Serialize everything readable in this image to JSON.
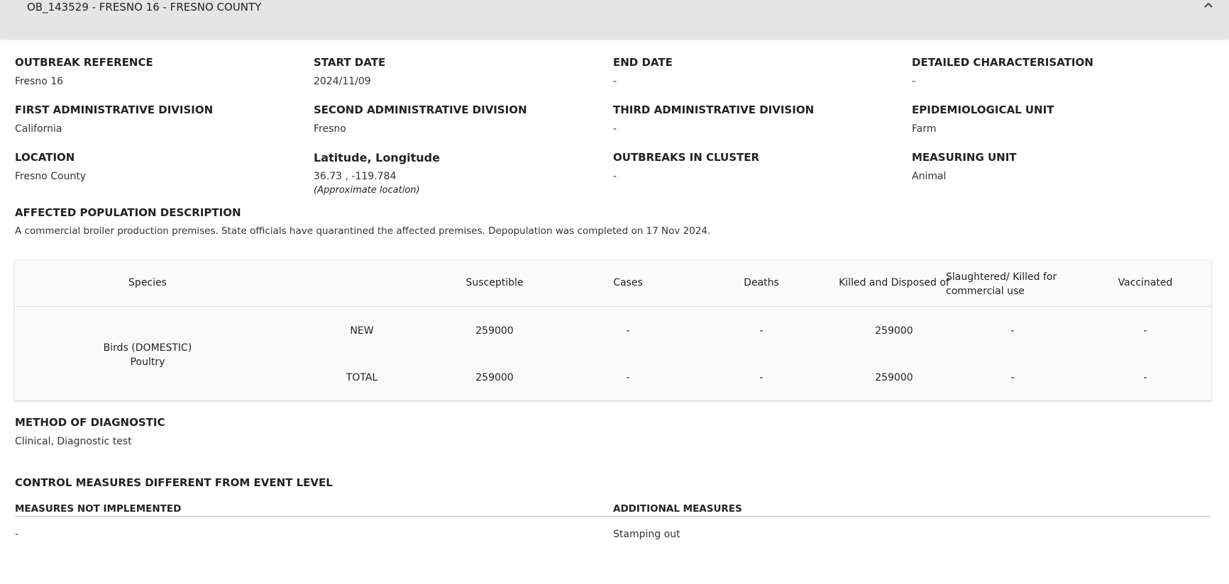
{
  "header": {
    "title": "OB_143529 - FRESNO 16 - FRESNO COUNTY",
    "collapse_icon": "chevron-up-icon"
  },
  "fields": {
    "outbreak_reference": {
      "label": "OUTBREAK REFERENCE",
      "value": "Fresno 16"
    },
    "start_date": {
      "label": "START DATE",
      "value": "2024/11/09"
    },
    "end_date": {
      "label": "END DATE",
      "value": "-"
    },
    "detailed_characterisation": {
      "label": "DETAILED CHARACTERISATION",
      "value": "-"
    },
    "first_admin_division": {
      "label": "FIRST ADMINISTRATIVE DIVISION",
      "value": "California"
    },
    "second_admin_division": {
      "label": "SECOND ADMINISTRATIVE DIVISION",
      "value": "Fresno"
    },
    "third_admin_division": {
      "label": "THIRD ADMINISTRATIVE DIVISION",
      "value": "-"
    },
    "epidemiological_unit": {
      "label": "EPIDEMIOLOGICAL UNIT",
      "value": "Farm"
    },
    "location": {
      "label": "LOCATION",
      "value": "Fresno County"
    },
    "lat_long": {
      "label": "Latitude, Longitude",
      "value": "36.73 , -119.784",
      "note": "(Approximate location)"
    },
    "outbreaks_in_cluster": {
      "label": "OUTBREAKS IN CLUSTER",
      "value": "-"
    },
    "measuring_unit": {
      "label": "MEASURING UNIT",
      "value": "Animal"
    }
  },
  "affected_population": {
    "label": "AFFECTED POPULATION DESCRIPTION",
    "text": "A commercial broiler production premises. State officials have quarantined the affected premises. Depopulation was completed on 17 Nov 2024."
  },
  "table": {
    "headers": {
      "species": "Species",
      "susceptible": "Susceptible",
      "cases": "Cases",
      "deaths": "Deaths",
      "killed": "Killed and Disposed of",
      "slaughtered_line1": "Slaughtered/ Killed for",
      "slaughtered_line2": "commercial use",
      "vaccinated": "Vaccinated"
    },
    "species_line1": "Birds (DOMESTIC)",
    "species_line2": "Poultry",
    "rows": [
      {
        "type": "NEW",
        "susceptible": "259000",
        "cases": "-",
        "deaths": "-",
        "killed": "259000",
        "slaughtered": "-",
        "vaccinated": "-"
      },
      {
        "type": "TOTAL",
        "susceptible": "259000",
        "cases": "-",
        "deaths": "-",
        "killed": "259000",
        "slaughtered": "-",
        "vaccinated": "-"
      }
    ]
  },
  "diagnostic": {
    "label": "METHOD OF DIAGNOSTIC",
    "value": "Clinical, Diagnostic test"
  },
  "control_measures": {
    "label": "CONTROL MEASURES DIFFERENT FROM EVENT LEVEL",
    "not_implemented_label": "MEASURES NOT IMPLEMENTED",
    "not_implemented_value": "-",
    "additional_label": "ADDITIONAL MEASURES",
    "additional_value": "Stamping out"
  }
}
